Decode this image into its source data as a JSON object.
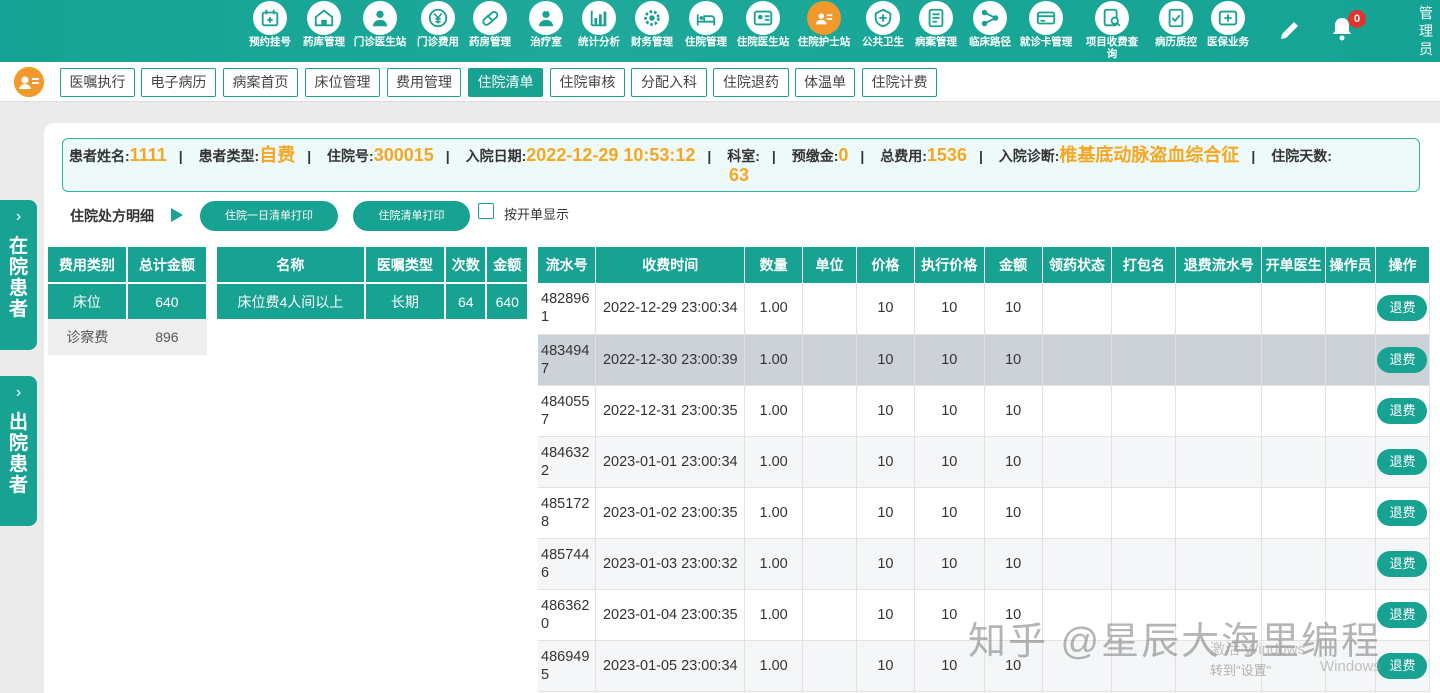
{
  "top_nav": {
    "items": [
      {
        "label": "预约挂号",
        "icon": "calendar-icon"
      },
      {
        "label": "药库管理",
        "icon": "warehouse-icon"
      },
      {
        "label": "门诊医生站",
        "icon": "doctor-icon"
      },
      {
        "label": "门诊费用",
        "icon": "yen-icon"
      },
      {
        "label": "药房管理",
        "icon": "pill-icon"
      },
      {
        "label": "治疗室",
        "icon": "nurse-icon"
      },
      {
        "label": "统计分析",
        "icon": "chart-icon"
      },
      {
        "label": "财务管理",
        "icon": "gear-icon"
      },
      {
        "label": "住院管理",
        "icon": "bed-icon"
      },
      {
        "label": "住院医生站",
        "icon": "doctor-card-icon"
      },
      {
        "label": "住院护士站",
        "icon": "nurse-card-icon"
      },
      {
        "label": "公共卫生",
        "icon": "shield-cross-icon"
      },
      {
        "label": "病案管理",
        "icon": "record-icon"
      },
      {
        "label": "临床路径",
        "icon": "path-icon"
      },
      {
        "label": "就诊卡管理",
        "icon": "card-icon"
      },
      {
        "label": "项目收费查询",
        "icon": "fee-search-icon"
      },
      {
        "label": "病历质控",
        "icon": "quality-icon"
      },
      {
        "label": "医保业务",
        "icon": "insurance-icon"
      }
    ],
    "active_label": "住院护士站",
    "notification_count": "0",
    "user": "管理员"
  },
  "sub_tabs": [
    "医嘱执行",
    "电子病历",
    "病案首页",
    "床位管理",
    "费用管理",
    "住院清单",
    "住院审核",
    "分配入科",
    "住院退药",
    "体温单",
    "住院计费"
  ],
  "active_sub_tab": "住院清单",
  "side_tabs": {
    "inpatients": "在院患者",
    "discharged": "出院患者"
  },
  "patient": {
    "name_label": "患者姓名:",
    "name": "1111",
    "type_label": "患者类型:",
    "type": "自费",
    "admission_no_label": "住院号:",
    "admission_no": "300015",
    "admission_date_label": "入院日期:",
    "admission_date": "2022-12-29 10:53:12",
    "dept_label": "科室:",
    "dept": "",
    "prepay_label": "预缴金:",
    "prepay": "0",
    "total_label": "总费用:",
    "total": "1536",
    "diagnosis_label": "入院诊断:",
    "diagnosis": "椎基底动脉盗血综合征",
    "days_label": "住院天数:",
    "days": "63"
  },
  "section": {
    "title": "住院处方明细",
    "print_daily": "住院一日清单打印",
    "print_list": "住院清单打印",
    "by_order_label": "按开单显示"
  },
  "fee_category_table": {
    "headers": [
      "费用类别",
      "总计金额"
    ],
    "rows": [
      {
        "category": "床位",
        "amount": "640"
      },
      {
        "category": "诊察费",
        "amount": "896"
      }
    ]
  },
  "item_table": {
    "headers": [
      "名称",
      "医嘱类型",
      "次数",
      "金额"
    ],
    "rows": [
      {
        "name": "床位费4人间以上",
        "order_type": "长期",
        "times": "64",
        "amount": "640"
      }
    ]
  },
  "detail_table": {
    "headers": [
      "流水号",
      "收费时间",
      "数量",
      "单位",
      "价格",
      "执行价格",
      "金额",
      "领药状态",
      "打包名",
      "退费流水号",
      "开单医生",
      "操作员",
      "操作"
    ],
    "refund_label": "退费",
    "rows": [
      {
        "serial": "4828961",
        "time": "2022-12-29 23:00:34",
        "qty": "1.00",
        "unit": "",
        "price": "10",
        "exec_price": "10",
        "amount": "10"
      },
      {
        "serial": "4834947",
        "time": "2022-12-30 23:00:39",
        "qty": "1.00",
        "unit": "",
        "price": "10",
        "exec_price": "10",
        "amount": "10"
      },
      {
        "serial": "4840557",
        "time": "2022-12-31 23:00:35",
        "qty": "1.00",
        "unit": "",
        "price": "10",
        "exec_price": "10",
        "amount": "10"
      },
      {
        "serial": "4846322",
        "time": "2023-01-01 23:00:34",
        "qty": "1.00",
        "unit": "",
        "price": "10",
        "exec_price": "10",
        "amount": "10"
      },
      {
        "serial": "4851728",
        "time": "2023-01-02 23:00:35",
        "qty": "1.00",
        "unit": "",
        "price": "10",
        "exec_price": "10",
        "amount": "10"
      },
      {
        "serial": "4857446",
        "time": "2023-01-03 23:00:32",
        "qty": "1.00",
        "unit": "",
        "price": "10",
        "exec_price": "10",
        "amount": "10"
      },
      {
        "serial": "4863620",
        "time": "2023-01-04 23:00:35",
        "qty": "1.00",
        "unit": "",
        "price": "10",
        "exec_price": "10",
        "amount": "10"
      },
      {
        "serial": "4869495",
        "time": "2023-01-05 23:00:34",
        "qty": "1.00",
        "unit": "",
        "price": "10",
        "exec_price": "10",
        "amount": "10"
      }
    ]
  },
  "watermark": "知乎 @星辰大海里编程",
  "activation": {
    "line1": "激活 Windows",
    "line2": "转到\"设置\"",
    "line3": "Windows"
  },
  "colors": {
    "primary": "#18a292",
    "accent": "#f19a2b",
    "value": "#f5a623",
    "highlight_row": "#cdd2d9"
  }
}
